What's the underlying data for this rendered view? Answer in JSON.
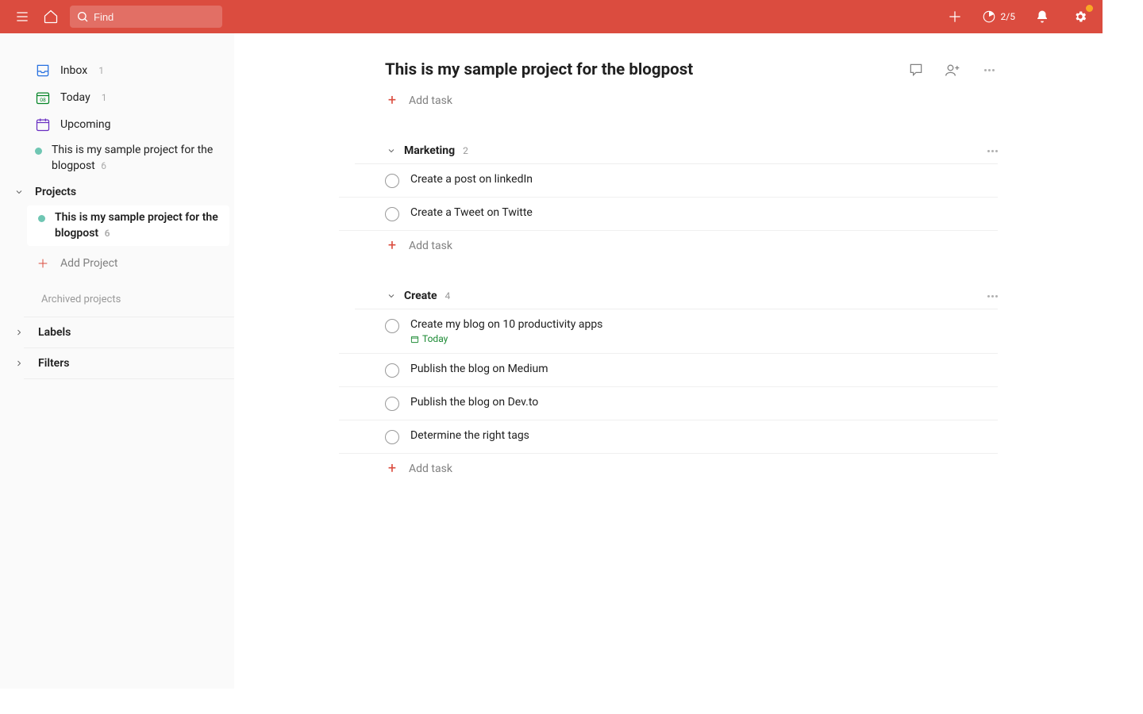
{
  "colors": {
    "brand": "#db4c3f",
    "project_dot": "#6fc6b3",
    "due_green": "#1b8a33"
  },
  "topbar": {
    "search_placeholder": "Find",
    "progress_text": "2/5"
  },
  "sidebar": {
    "inbox": {
      "label": "Inbox",
      "count": "1"
    },
    "today": {
      "label": "Today",
      "count": "1",
      "date_num": "08"
    },
    "upcoming": {
      "label": "Upcoming"
    },
    "favorite_project": {
      "name": "This is my sample project for the blogpost",
      "count": "6"
    },
    "projects_header": "Projects",
    "projects": [
      {
        "name": "This is my sample project for the blogpost",
        "count": "6"
      }
    ],
    "add_project_label": "Add Project",
    "archived_label": "Archived projects",
    "labels_header": "Labels",
    "filters_header": "Filters"
  },
  "main": {
    "project_title": "This is my sample project for the blogpost",
    "add_task_label": "Add task",
    "sections": [
      {
        "name": "Marketing",
        "count": "2",
        "tasks": [
          {
            "title": "Create a post on linkedIn"
          },
          {
            "title": "Create a Tweet on Twitte"
          }
        ]
      },
      {
        "name": "Create",
        "count": "4",
        "tasks": [
          {
            "title": "Create my blog on 10 productivity apps",
            "due": "Today"
          },
          {
            "title": "Publish the blog on Medium"
          },
          {
            "title": "Publish the blog on Dev.to"
          },
          {
            "title": "Determine the right tags"
          }
        ]
      }
    ]
  }
}
